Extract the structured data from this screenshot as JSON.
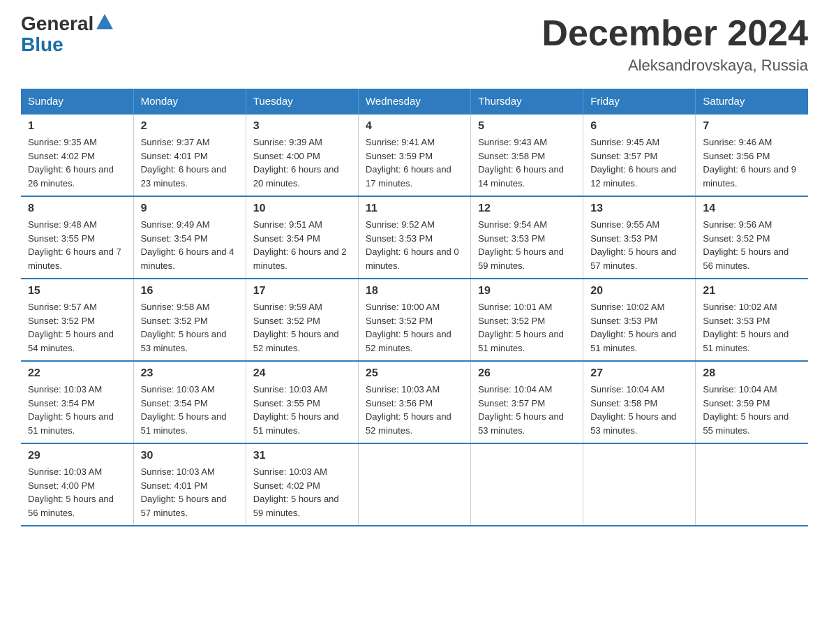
{
  "logo": {
    "general": "General",
    "blue": "Blue"
  },
  "title": "December 2024",
  "location": "Aleksandrovskaya, Russia",
  "weekdays": [
    "Sunday",
    "Monday",
    "Tuesday",
    "Wednesday",
    "Thursday",
    "Friday",
    "Saturday"
  ],
  "weeks": [
    [
      {
        "day": "1",
        "sunrise": "9:35 AM",
        "sunset": "4:02 PM",
        "daylight": "6 hours and 26 minutes."
      },
      {
        "day": "2",
        "sunrise": "9:37 AM",
        "sunset": "4:01 PM",
        "daylight": "6 hours and 23 minutes."
      },
      {
        "day": "3",
        "sunrise": "9:39 AM",
        "sunset": "4:00 PM",
        "daylight": "6 hours and 20 minutes."
      },
      {
        "day": "4",
        "sunrise": "9:41 AM",
        "sunset": "3:59 PM",
        "daylight": "6 hours and 17 minutes."
      },
      {
        "day": "5",
        "sunrise": "9:43 AM",
        "sunset": "3:58 PM",
        "daylight": "6 hours and 14 minutes."
      },
      {
        "day": "6",
        "sunrise": "9:45 AM",
        "sunset": "3:57 PM",
        "daylight": "6 hours and 12 minutes."
      },
      {
        "day": "7",
        "sunrise": "9:46 AM",
        "sunset": "3:56 PM",
        "daylight": "6 hours and 9 minutes."
      }
    ],
    [
      {
        "day": "8",
        "sunrise": "9:48 AM",
        "sunset": "3:55 PM",
        "daylight": "6 hours and 7 minutes."
      },
      {
        "day": "9",
        "sunrise": "9:49 AM",
        "sunset": "3:54 PM",
        "daylight": "6 hours and 4 minutes."
      },
      {
        "day": "10",
        "sunrise": "9:51 AM",
        "sunset": "3:54 PM",
        "daylight": "6 hours and 2 minutes."
      },
      {
        "day": "11",
        "sunrise": "9:52 AM",
        "sunset": "3:53 PM",
        "daylight": "6 hours and 0 minutes."
      },
      {
        "day": "12",
        "sunrise": "9:54 AM",
        "sunset": "3:53 PM",
        "daylight": "5 hours and 59 minutes."
      },
      {
        "day": "13",
        "sunrise": "9:55 AM",
        "sunset": "3:53 PM",
        "daylight": "5 hours and 57 minutes."
      },
      {
        "day": "14",
        "sunrise": "9:56 AM",
        "sunset": "3:52 PM",
        "daylight": "5 hours and 56 minutes."
      }
    ],
    [
      {
        "day": "15",
        "sunrise": "9:57 AM",
        "sunset": "3:52 PM",
        "daylight": "5 hours and 54 minutes."
      },
      {
        "day": "16",
        "sunrise": "9:58 AM",
        "sunset": "3:52 PM",
        "daylight": "5 hours and 53 minutes."
      },
      {
        "day": "17",
        "sunrise": "9:59 AM",
        "sunset": "3:52 PM",
        "daylight": "5 hours and 52 minutes."
      },
      {
        "day": "18",
        "sunrise": "10:00 AM",
        "sunset": "3:52 PM",
        "daylight": "5 hours and 52 minutes."
      },
      {
        "day": "19",
        "sunrise": "10:01 AM",
        "sunset": "3:52 PM",
        "daylight": "5 hours and 51 minutes."
      },
      {
        "day": "20",
        "sunrise": "10:02 AM",
        "sunset": "3:53 PM",
        "daylight": "5 hours and 51 minutes."
      },
      {
        "day": "21",
        "sunrise": "10:02 AM",
        "sunset": "3:53 PM",
        "daylight": "5 hours and 51 minutes."
      }
    ],
    [
      {
        "day": "22",
        "sunrise": "10:03 AM",
        "sunset": "3:54 PM",
        "daylight": "5 hours and 51 minutes."
      },
      {
        "day": "23",
        "sunrise": "10:03 AM",
        "sunset": "3:54 PM",
        "daylight": "5 hours and 51 minutes."
      },
      {
        "day": "24",
        "sunrise": "10:03 AM",
        "sunset": "3:55 PM",
        "daylight": "5 hours and 51 minutes."
      },
      {
        "day": "25",
        "sunrise": "10:03 AM",
        "sunset": "3:56 PM",
        "daylight": "5 hours and 52 minutes."
      },
      {
        "day": "26",
        "sunrise": "10:04 AM",
        "sunset": "3:57 PM",
        "daylight": "5 hours and 53 minutes."
      },
      {
        "day": "27",
        "sunrise": "10:04 AM",
        "sunset": "3:58 PM",
        "daylight": "5 hours and 53 minutes."
      },
      {
        "day": "28",
        "sunrise": "10:04 AM",
        "sunset": "3:59 PM",
        "daylight": "5 hours and 55 minutes."
      }
    ],
    [
      {
        "day": "29",
        "sunrise": "10:03 AM",
        "sunset": "4:00 PM",
        "daylight": "5 hours and 56 minutes."
      },
      {
        "day": "30",
        "sunrise": "10:03 AM",
        "sunset": "4:01 PM",
        "daylight": "5 hours and 57 minutes."
      },
      {
        "day": "31",
        "sunrise": "10:03 AM",
        "sunset": "4:02 PM",
        "daylight": "5 hours and 59 minutes."
      },
      null,
      null,
      null,
      null
    ]
  ],
  "labels": {
    "sunrise": "Sunrise:",
    "sunset": "Sunset:",
    "daylight": "Daylight:"
  }
}
